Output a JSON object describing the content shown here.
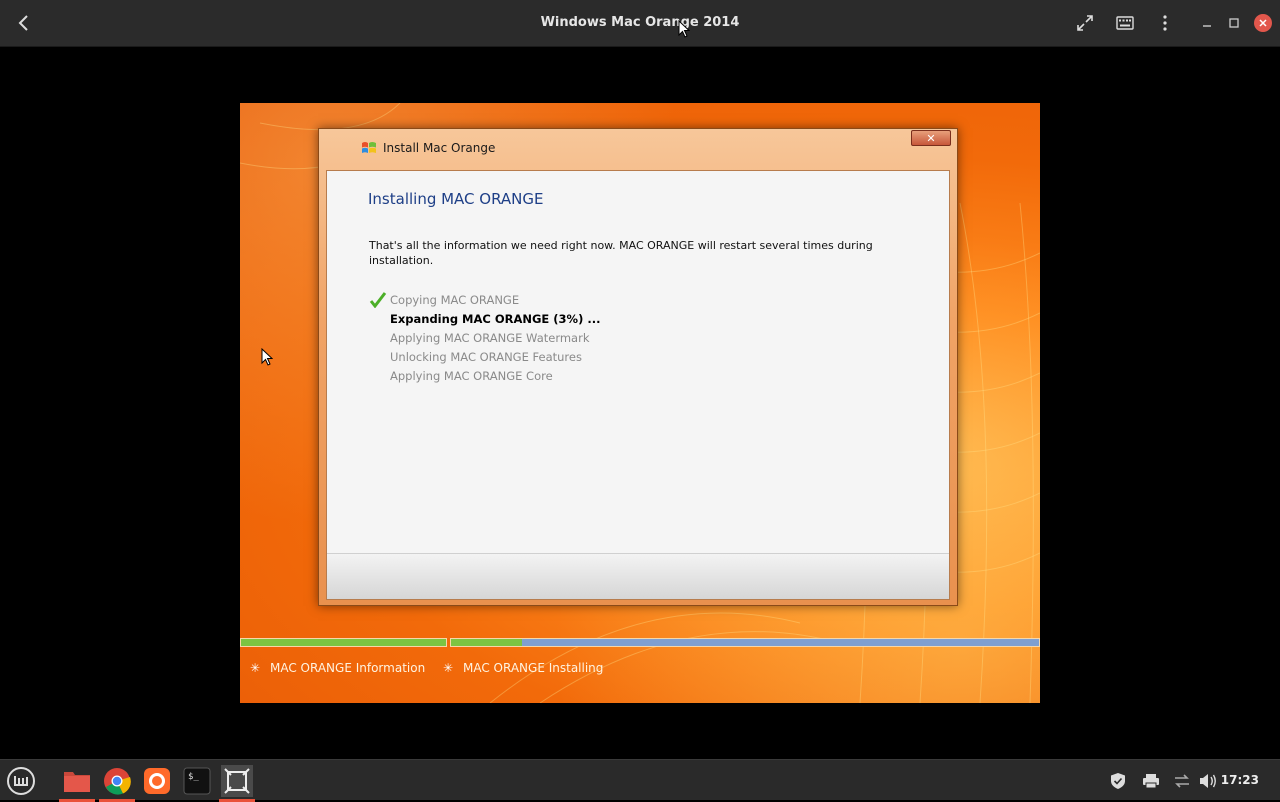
{
  "window": {
    "title": "Windows Mac Orange 2014"
  },
  "installer": {
    "caption": "Install Mac Orange",
    "heading": "Installing MAC ORANGE",
    "intro": "That's all the information we need right now. MAC ORANGE will restart several times during installation.",
    "close_label": "✕",
    "steps": [
      {
        "label": "Copying MAC ORANGE",
        "state": "done"
      },
      {
        "label": "Expanding MAC ORANGE (3%) ...",
        "state": "active"
      },
      {
        "label": "Applying MAC ORANGE Watermark",
        "state": "pending"
      },
      {
        "label": "Unlocking MAC ORANGE Features",
        "state": "pending"
      },
      {
        "label": "Applying MAC ORANGE Core",
        "state": "pending"
      }
    ]
  },
  "phases": {
    "info": "MAC ORANGE Information",
    "installing": "MAC ORANGE Installing",
    "installing_progress": 0.12
  },
  "taskbar": {
    "apps": [
      "menu-icon",
      "files-icon",
      "chrome-icon",
      "firefox-icon",
      "terminal-icon",
      "vm-app-icon"
    ],
    "clock": "17:23"
  },
  "colors": {
    "accent": "#e9523a",
    "progress_green": "#7cc442",
    "progress_blue": "#7f9fd0",
    "heading_blue": "#1e3f87"
  }
}
